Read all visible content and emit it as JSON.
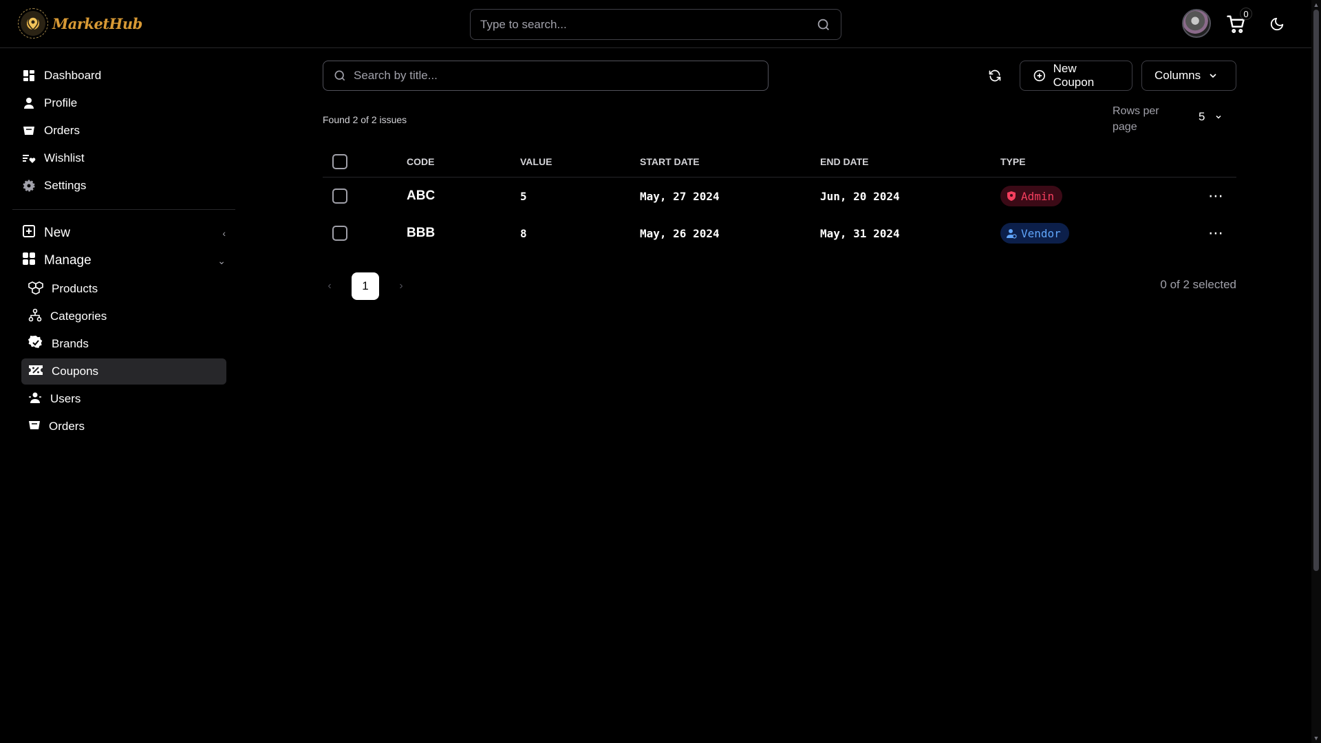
{
  "app": {
    "name": "MarketHub"
  },
  "header": {
    "search_placeholder": "Type to search...",
    "cart_count": "0"
  },
  "sidebar": {
    "items": [
      {
        "label": "Dashboard",
        "icon": "dashboard-icon"
      },
      {
        "label": "Profile",
        "icon": "user-icon"
      },
      {
        "label": "Orders",
        "icon": "basket-icon"
      },
      {
        "label": "Wishlist",
        "icon": "wishlist-icon"
      },
      {
        "label": "Settings",
        "icon": "gear-icon"
      }
    ],
    "group_new": {
      "label": "New"
    },
    "group_manage": {
      "label": "Manage",
      "items": [
        {
          "label": "Products",
          "icon": "boxes-icon"
        },
        {
          "label": "Categories",
          "icon": "hierarchy-icon"
        },
        {
          "label": "Brands",
          "icon": "badge-check-icon"
        },
        {
          "label": "Coupons",
          "icon": "coupon-icon",
          "active": true
        },
        {
          "label": "Users",
          "icon": "users-icon"
        },
        {
          "label": "Orders",
          "icon": "basket-icon"
        }
      ]
    }
  },
  "toolbar": {
    "search_placeholder": "Search by title...",
    "new_label": "New Coupon",
    "columns_label": "Columns"
  },
  "summary": {
    "found_text": "Found 2 of 2 issues",
    "rows_per_page_label": "Rows per page",
    "rows_per_page_value": "5",
    "selected_text": "0 of 2 selected"
  },
  "table": {
    "headers": {
      "code": "CODE",
      "value": "VALUE",
      "start": "START DATE",
      "end": "END DATE",
      "type": "TYPE"
    },
    "rows": [
      {
        "code": "ABC",
        "value": "5",
        "start": "May, 27 2024",
        "end": "Jun, 20 2024",
        "type": "Admin",
        "type_color": "#f43f5e"
      },
      {
        "code": "BBB",
        "value": "8",
        "start": "May, 26 2024",
        "end": "May, 31 2024",
        "type": "Vendor",
        "type_color": "#60a5fa"
      }
    ]
  },
  "pagination": {
    "current_page": "1"
  }
}
